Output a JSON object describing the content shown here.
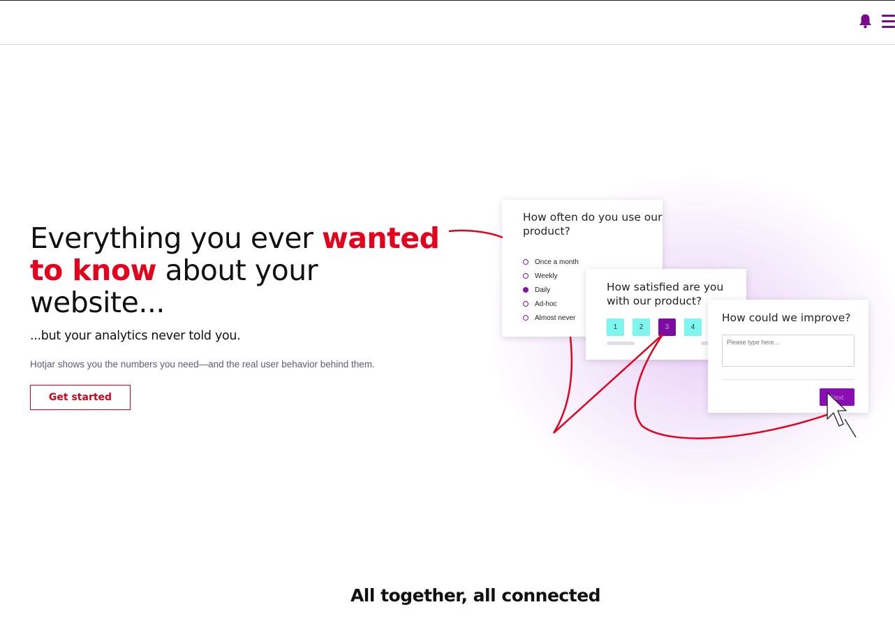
{
  "header": {
    "bell_icon": "bell-icon",
    "menu_icon": "hamburger-menu-icon",
    "accent_color": "#7a0a8c"
  },
  "hero": {
    "title_part1": "Everything you ever ",
    "title_highlight": "wanted to know",
    "title_part2": " about your website...",
    "highlight_color": "#e5001c",
    "subtitle": "...but your analytics never told you.",
    "description": "Hotjar shows you the numbers you need—and the real user behavior behind them.",
    "cta_label": "Get started"
  },
  "illustration": {
    "card1": {
      "question": "How often do you use our product?",
      "options": [
        "Once a month",
        "Weekly",
        "Daily",
        "Ad-hoc",
        "Almost never"
      ],
      "selected": "Daily"
    },
    "card2": {
      "question": "How satisfied are you with our product?",
      "scale": [
        "1",
        "2",
        "3",
        "4"
      ],
      "selected": "3"
    },
    "card3": {
      "question": "How could we improve?",
      "placeholder": "Please type here...",
      "next_label": "Next"
    },
    "cursor_icon": "cursor-arrow-icon"
  },
  "section": {
    "title": "All together, all connected"
  }
}
